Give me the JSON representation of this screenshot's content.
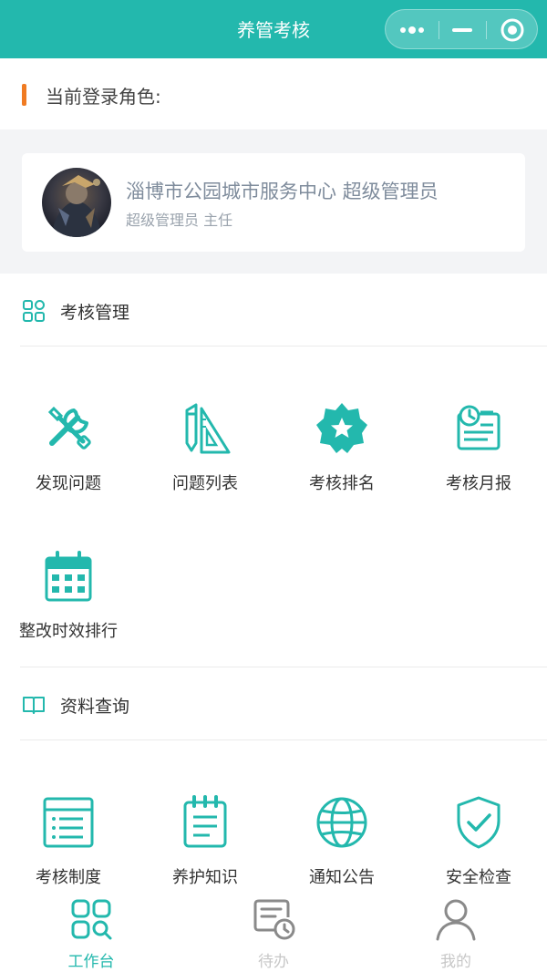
{
  "window": {
    "title": "养管考核"
  },
  "colors": {
    "accent": "#23b8ad",
    "role_marker": "#f07b22",
    "tab_inactive": "#c7c7c7"
  },
  "role": {
    "label": "当前登录角色:"
  },
  "user": {
    "name": "淄博市公园城市服务中心 超级管理员",
    "role_line": "超级管理员 主任"
  },
  "sections": {
    "assessment": {
      "title": "考核管理",
      "icon": "grid-apps-icon",
      "items": [
        {
          "label": "发现问题",
          "icon": "tools-icon"
        },
        {
          "label": "问题列表",
          "icon": "pencil-ruler-icon"
        },
        {
          "label": "考核排名",
          "icon": "star-badge-icon"
        },
        {
          "label": "考核月报",
          "icon": "report-clipboard-icon"
        },
        {
          "label": "整改时效排行",
          "icon": "calendar-icon"
        }
      ]
    },
    "resources": {
      "title": "资料查询",
      "icon": "book-icon",
      "items": [
        {
          "label": "考核制度",
          "icon": "document-list-icon"
        },
        {
          "label": "养护知识",
          "icon": "notepad-icon"
        },
        {
          "label": "通知公告",
          "icon": "globe-icon"
        },
        {
          "label": "安全检查",
          "icon": "shield-check-icon"
        }
      ]
    }
  },
  "tabbar": [
    {
      "label": "工作台",
      "icon": "workbench-icon",
      "active": true
    },
    {
      "label": "待办",
      "icon": "todo-clock-icon",
      "active": false
    },
    {
      "label": "我的",
      "icon": "user-icon",
      "active": false
    }
  ]
}
